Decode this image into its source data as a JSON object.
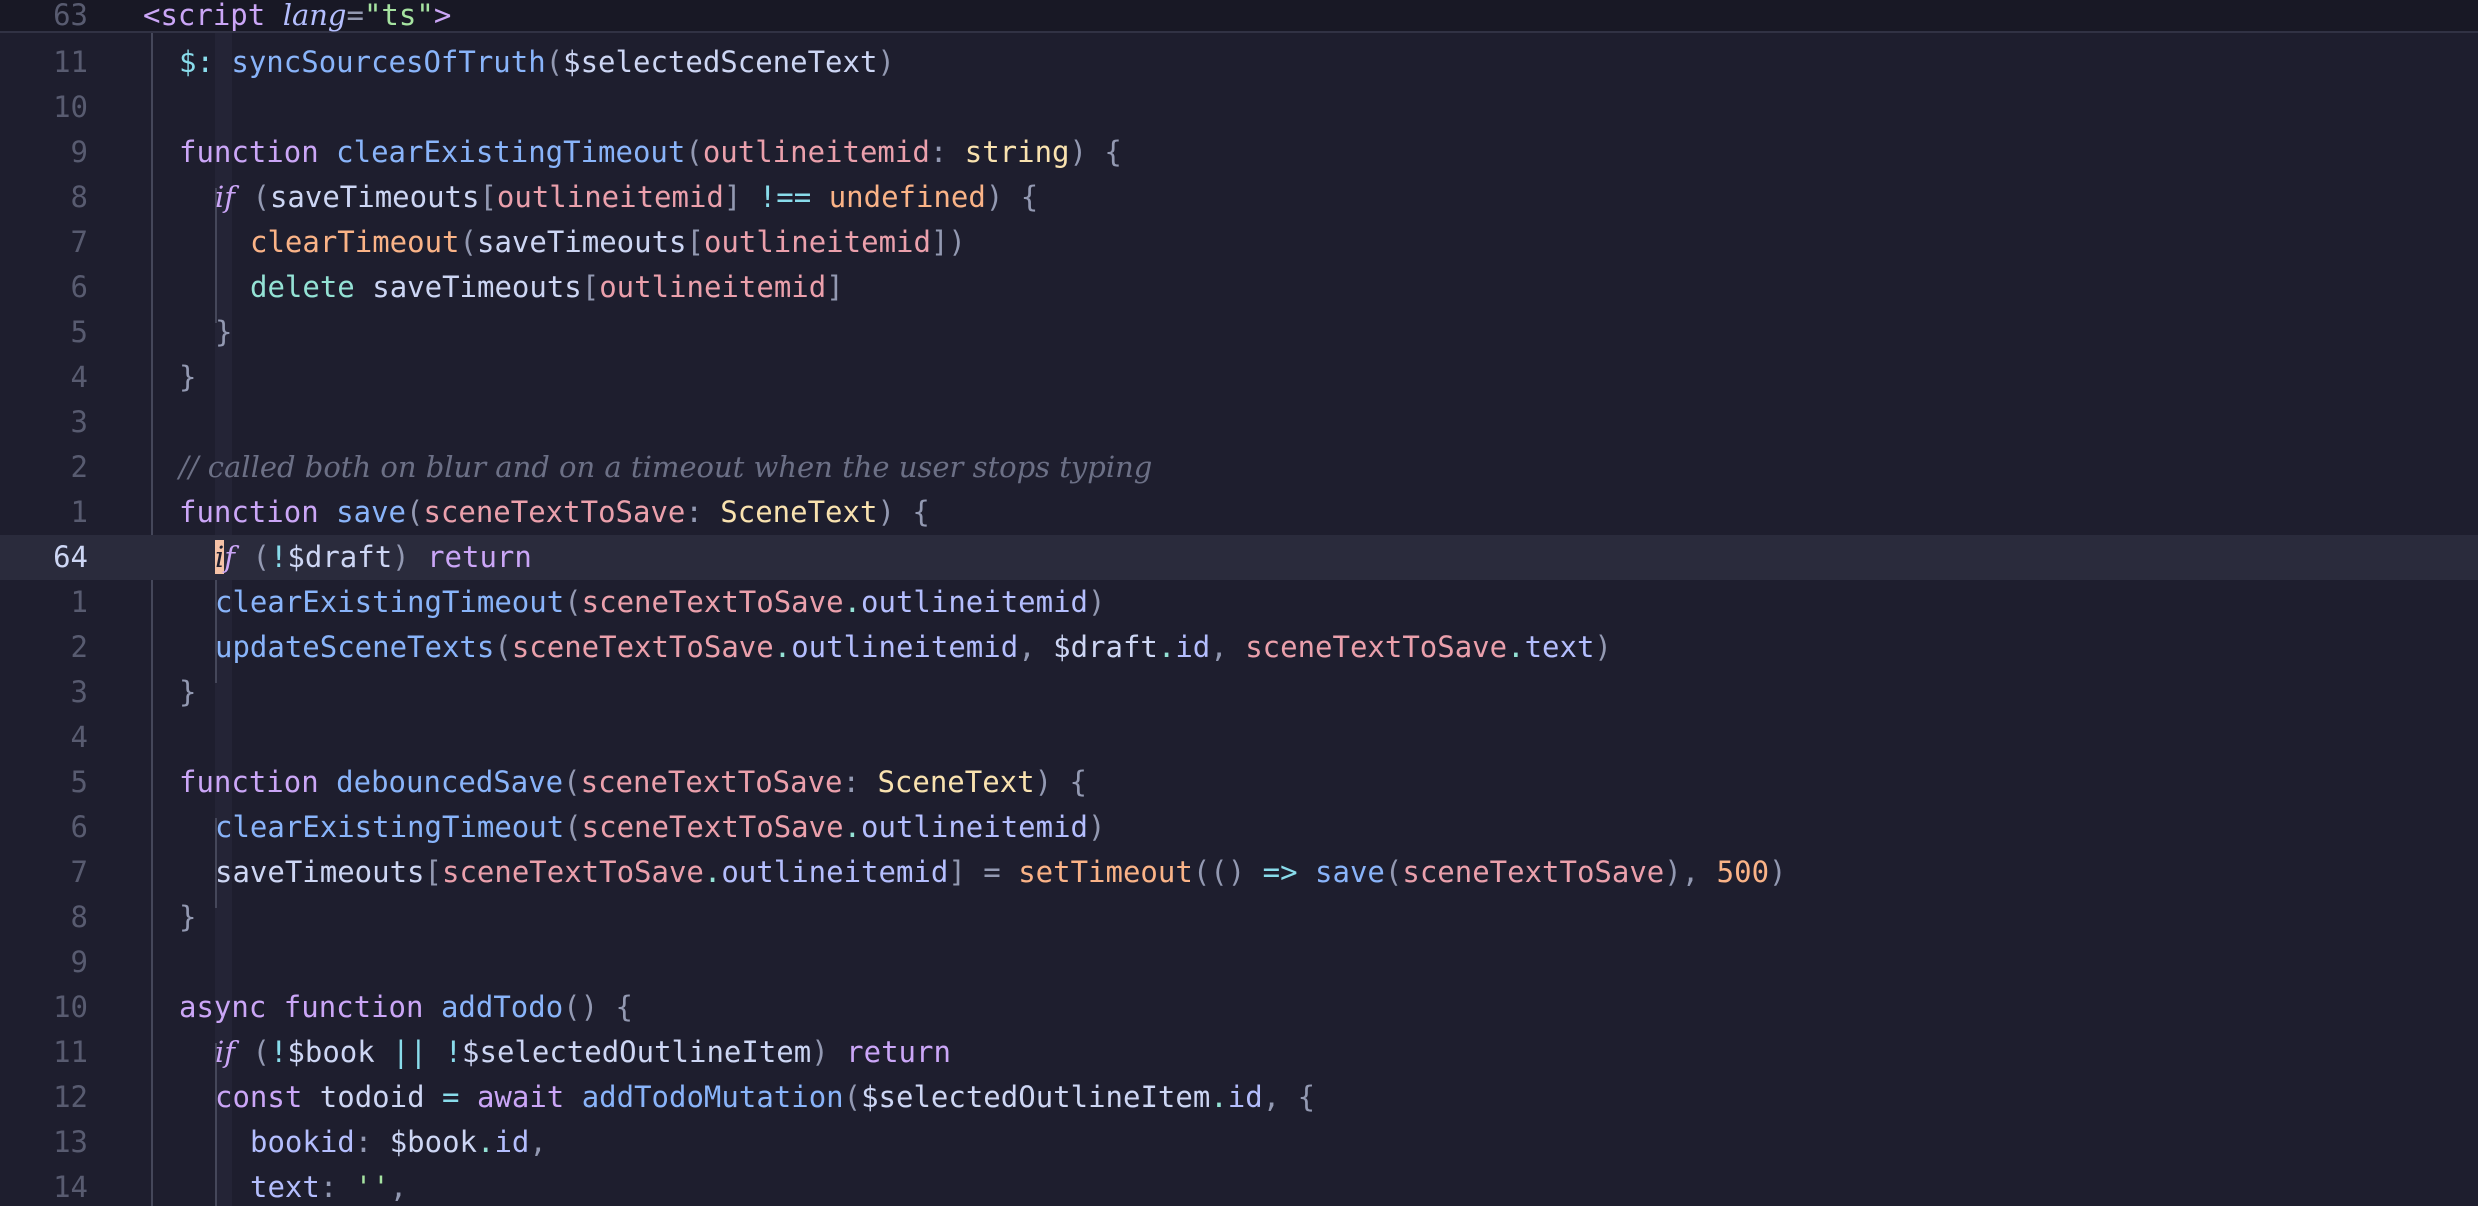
{
  "sticky": {
    "line_number": "63",
    "tag_open": "<script",
    "attr_name": "lang",
    "attr_eq": "=",
    "attr_value": "\"ts\"",
    "tag_close": ">"
  },
  "lines": [
    {
      "n": "11",
      "t": [
        "$:",
        " ",
        "syncSourcesOfTruth",
        "(",
        "$selectedSceneText",
        ")"
      ]
    },
    {
      "n": "10"
    },
    {
      "n": "9",
      "t": [
        "function",
        " ",
        "clearExistingTimeout",
        "(",
        "outlineitemid",
        ": ",
        "string",
        ") {"
      ]
    },
    {
      "n": "8",
      "t": [
        "if",
        " (",
        "saveTimeouts",
        "[",
        "outlineitemid",
        "]",
        " !== ",
        "undefined",
        ") {"
      ]
    },
    {
      "n": "7",
      "t": [
        "clearTimeout",
        "(",
        "saveTimeouts",
        "[",
        "outlineitemid",
        "])"
      ]
    },
    {
      "n": "6",
      "t": [
        "delete",
        " ",
        "saveTimeouts",
        "[",
        "outlineitemid",
        "]"
      ]
    },
    {
      "n": "5",
      "t": [
        "}"
      ]
    },
    {
      "n": "4",
      "t": [
        "}"
      ]
    },
    {
      "n": "3"
    },
    {
      "n": "2",
      "t": [
        "// called both on blur and on a timeout when the user stops typing"
      ]
    },
    {
      "n": "1",
      "t": [
        "function",
        " ",
        "save",
        "(",
        "sceneTextToSave",
        ": ",
        "SceneText",
        ") {"
      ]
    },
    {
      "n": "64",
      "t": [
        "i",
        "f",
        " (",
        "!",
        "$draft",
        ") ",
        "return"
      ]
    },
    {
      "n": "1",
      "t": [
        "clearExistingTimeout",
        "(",
        "sceneTextToSave",
        ".",
        "outlineitemid",
        ")"
      ]
    },
    {
      "n": "2",
      "t": [
        "updateSceneTexts",
        "(",
        "sceneTextToSave",
        ".",
        "outlineitemid",
        ", ",
        "$draft",
        ".",
        "id",
        ", ",
        "sceneTextToSave",
        ".",
        "text",
        ")"
      ]
    },
    {
      "n": "3",
      "t": [
        "}"
      ]
    },
    {
      "n": "4"
    },
    {
      "n": "5",
      "t": [
        "function",
        " ",
        "debouncedSave",
        "(",
        "sceneTextToSave",
        ": ",
        "SceneText",
        ") {"
      ]
    },
    {
      "n": "6",
      "t": [
        "clearExistingTimeout",
        "(",
        "sceneTextToSave",
        ".",
        "outlineitemid",
        ")"
      ]
    },
    {
      "n": "7",
      "t": [
        "saveTimeouts",
        "[",
        "sceneTextToSave",
        ".",
        "outlineitemid",
        "]",
        " = ",
        "setTimeout",
        "(() ",
        "=>",
        " ",
        "save",
        "(",
        "sceneTextToSave",
        "), ",
        "500",
        ")"
      ]
    },
    {
      "n": "8",
      "t": [
        "}"
      ]
    },
    {
      "n": "9"
    },
    {
      "n": "10",
      "t": [
        "async",
        " ",
        "function",
        " ",
        "addTodo",
        "() {"
      ]
    },
    {
      "n": "11",
      "t": [
        "if",
        " (",
        "!",
        "$book",
        " || ",
        "!",
        "$selectedOutlineItem",
        ") ",
        "return"
      ]
    },
    {
      "n": "12",
      "t": [
        "const",
        " ",
        "todoid",
        " = ",
        "await",
        " ",
        "addTodoMutation",
        "(",
        "$selectedOutlineItem",
        ".",
        "id",
        ", {"
      ]
    },
    {
      "n": "13",
      "t": [
        "bookid",
        ": ",
        "$book",
        ".",
        "id",
        ","
      ]
    },
    {
      "n": "14",
      "t": [
        "text",
        ": ",
        "''",
        ","
      ]
    }
  ]
}
